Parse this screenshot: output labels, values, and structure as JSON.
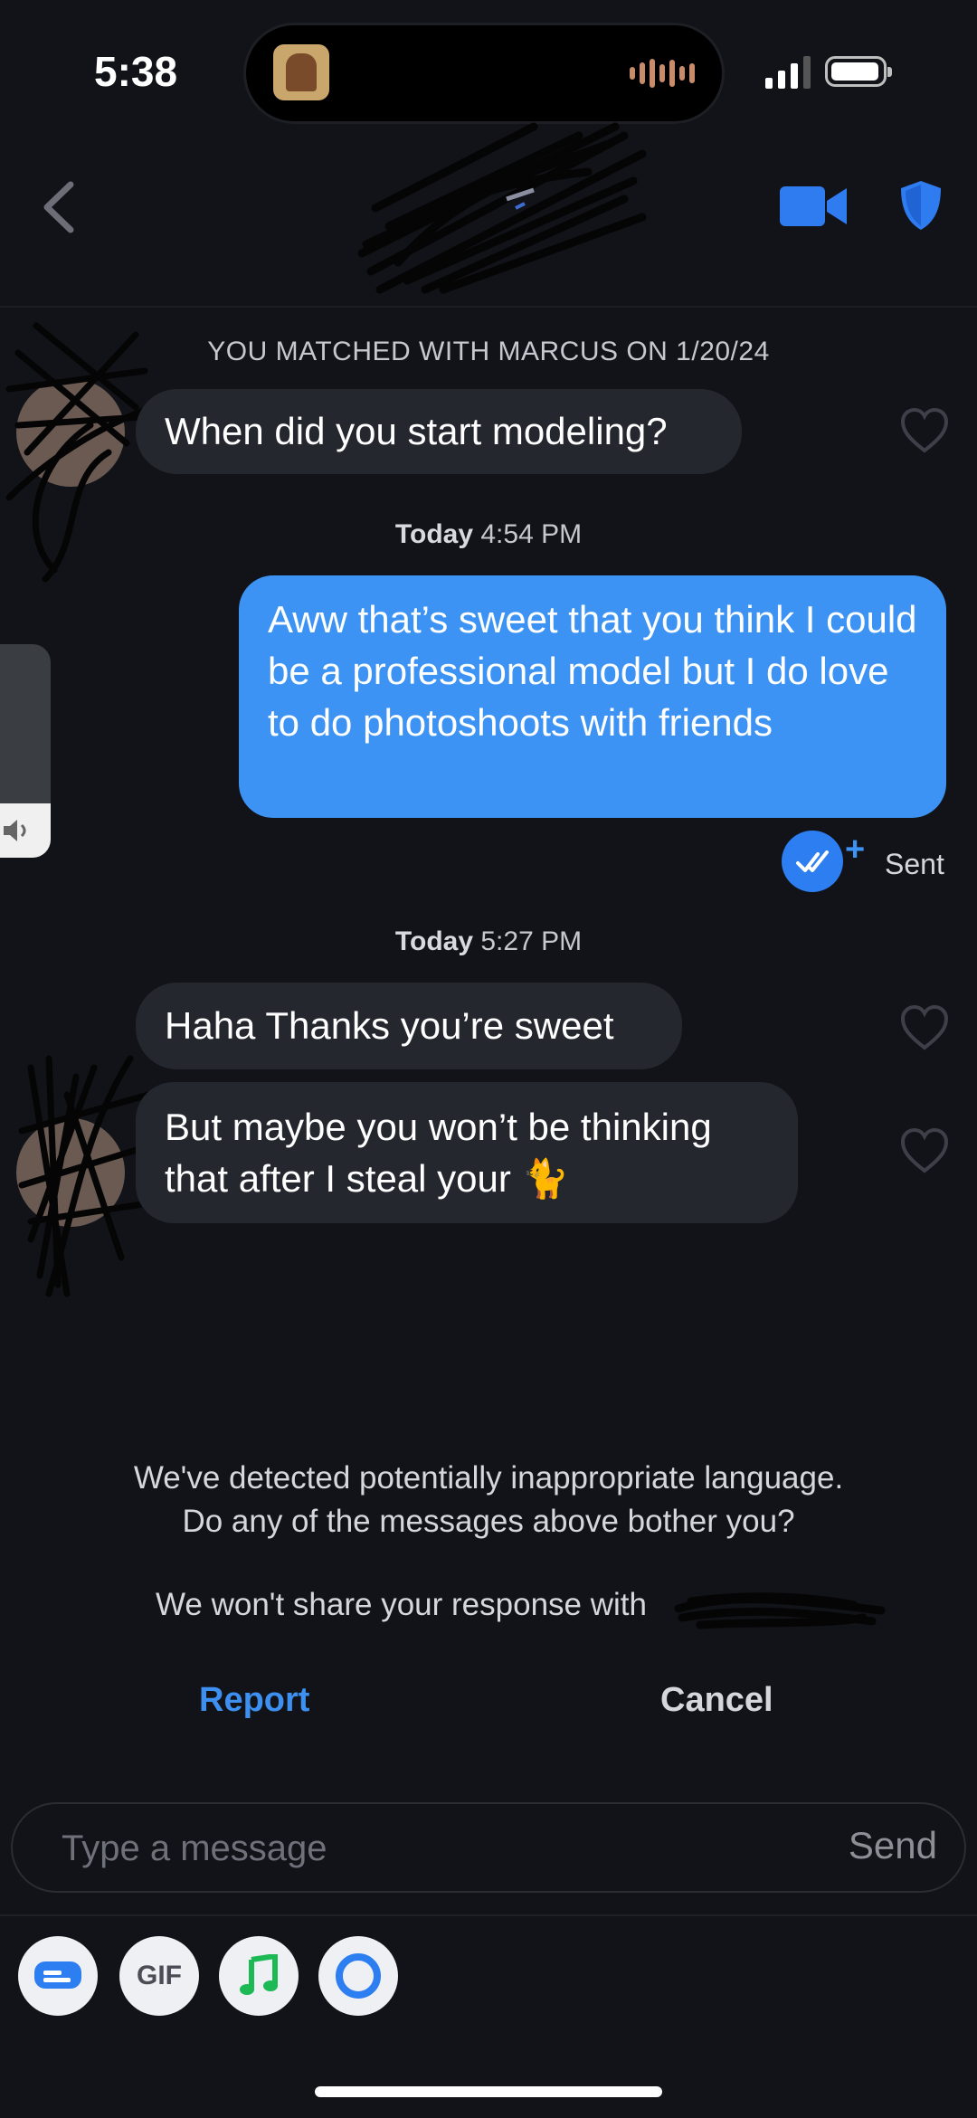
{
  "status_bar": {
    "time": "5:38"
  },
  "chat": {
    "match_banner": "YOU MATCHED WITH MARCUS ON 1/20/24",
    "messages": [
      {
        "text": "When did you start modeling?"
      },
      {
        "timestamp_day": "Today",
        "timestamp_time": "4:54 PM",
        "text": "Aww that’s sweet that you think I could be a professional model but I do love to do photoshoots with friends",
        "status": "Sent"
      },
      {
        "timestamp_day": "Today",
        "timestamp_time": "5:27 PM",
        "text": "Haha Thanks you’re sweet"
      },
      {
        "text": "But maybe you won’t be thinking that after I steal your 🐈"
      }
    ]
  },
  "prompt": {
    "line1": "We've detected potentially inappropriate language.",
    "line2": "Do any of the messages above bother you?",
    "line3": "We won't share your response with",
    "report_label": "Report",
    "cancel_label": "Cancel"
  },
  "composer": {
    "placeholder": "Type a message",
    "send_label": "Send",
    "gif_label": "GIF"
  },
  "colors": {
    "accent": "#3d93f3",
    "background": "#111318",
    "incoming_bubble": "#25272f"
  }
}
